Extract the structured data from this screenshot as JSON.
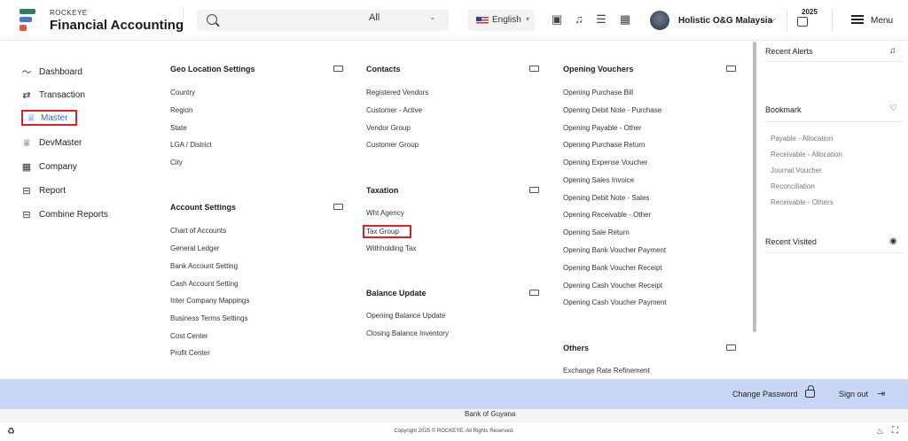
{
  "header": {
    "brand_small": "ROCKEYE",
    "brand_big": "Financial Accounting",
    "search_placeholder": "",
    "search_scope": "All",
    "language": "English",
    "company": "Holistic O&G Malaysia",
    "year": "2025",
    "menu_label": "Menu"
  },
  "sidebar": {
    "items": [
      {
        "label": "Dashboard",
        "icon": "dashboard-icon",
        "glyph": "〜"
      },
      {
        "label": "Transaction",
        "icon": "swap-icon",
        "glyph": "⇄"
      },
      {
        "label": "Master",
        "icon": "crown-icon",
        "glyph": "♕",
        "active": true
      },
      {
        "label": "DevMaster",
        "icon": "crown-icon",
        "glyph": "♕"
      },
      {
        "label": "Company",
        "icon": "building-icon",
        "glyph": "▦"
      },
      {
        "label": "Report",
        "icon": "report-icon",
        "glyph": "⊟"
      },
      {
        "label": "Combine Reports",
        "icon": "report-icon",
        "glyph": "⊟"
      }
    ]
  },
  "mega": {
    "geo": {
      "title": "Geo Location Settings",
      "links": [
        "Country",
        "Region",
        "State",
        "LGA / District",
        "City"
      ]
    },
    "account": {
      "title": "Account Settings",
      "links": [
        "Chart of Accounts",
        "General Ledger",
        "Bank Account Setting",
        "Cash Account Setting",
        "Inter Company Mappings",
        "Business Terms Settings",
        "Cost Center",
        "Profit Center"
      ]
    },
    "contacts": {
      "title": "Contacts",
      "links": [
        "Registered Vendors",
        "Customer - Active",
        "Vendor Group",
        "Customer Group"
      ]
    },
    "taxation": {
      "title": "Taxation",
      "links": [
        "Wht Agency",
        "Tax Group",
        "Withholding Tax"
      ]
    },
    "balance": {
      "title": "Balance Update",
      "links": [
        "Opening Balance Update",
        "Closing Balance Inventory"
      ]
    },
    "vouchers": {
      "title": "Opening Vouchers",
      "links": [
        "Opening Purchase Bill",
        "Opening Debit Note - Purchase",
        "Opening Payable - Other",
        "Opening Purchase Return",
        "Opening Expense Voucher",
        "Opening Sales Invoice",
        "Opening Debit Note - Sales",
        "Opening Receivable - Other",
        "Opening Sale Return",
        "Opening Bank Voucher Payment",
        "Opening Bank Voucher Receipt",
        "Opening Cash Voucher Receipt",
        "Opening Cash Voucher Payment"
      ]
    },
    "others": {
      "title": "Others",
      "links": [
        "Exchange Rate Refinement"
      ]
    }
  },
  "right_panel": {
    "alerts_title": "Recent Alerts",
    "bookmark_title": "Bookmark",
    "bookmarks": [
      "Payable - Allocation",
      "Receivable - Allocation",
      "Journal Voucher",
      "Reconciliation",
      "Receivable - Others"
    ],
    "visited_title": "Recent Visited"
  },
  "bottom": {
    "change_password": "Change Password",
    "sign_out": "Sign out",
    "underlying_text": "Bank of Guyana",
    "copyright": "Copyright 2025 © ROCKEYE. All Rights Reserved."
  },
  "colors": {
    "highlight_border": "#e01e26",
    "active_text": "#2e6fd8",
    "bottom_bar": "#c9d6f5"
  }
}
